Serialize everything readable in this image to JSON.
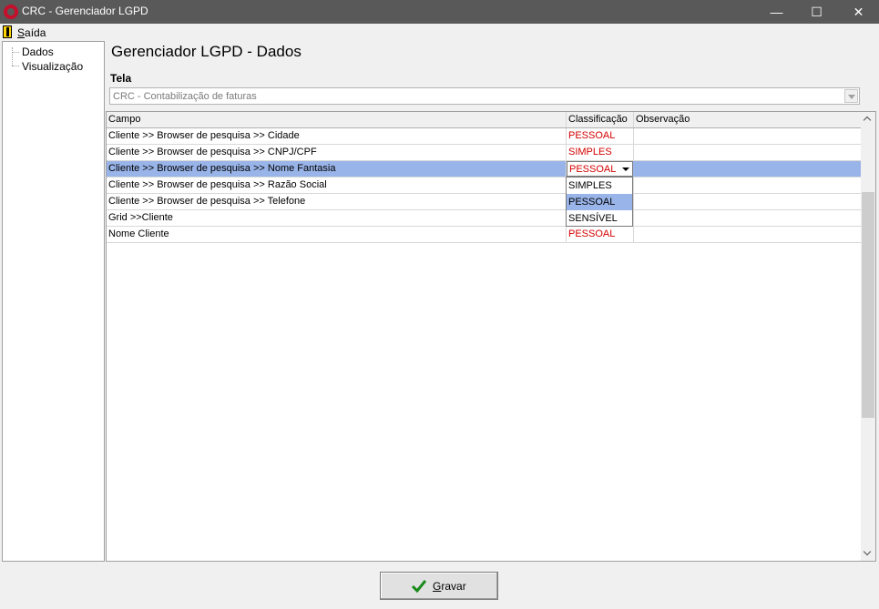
{
  "window": {
    "title": "CRC - Gerenciador LGPD",
    "minimize": "—",
    "maximize": "☐",
    "close": "✕"
  },
  "menu": {
    "exit_label_u": "S",
    "exit_label_rest": "aída"
  },
  "tree": {
    "items": [
      "Dados",
      "Visualização"
    ]
  },
  "page": {
    "title": "Gerenciador LGPD - Dados",
    "tela_label": "Tela"
  },
  "screen_select": {
    "value": "CRC - Contabilização de faturas"
  },
  "grid": {
    "columns": [
      "Campo",
      "Classificação",
      "Observação"
    ],
    "rows": [
      {
        "campo": "Cliente >> Browser de pesquisa >> Cidade",
        "classificacao": "PESSOAL",
        "observacao": ""
      },
      {
        "campo": "Cliente >> Browser de pesquisa >> CNPJ/CPF",
        "classificacao": "SIMPLES",
        "observacao": ""
      },
      {
        "campo": "Cliente >> Browser de pesquisa >> Nome Fantasia",
        "classificacao": "PESSOAL",
        "observacao": ""
      },
      {
        "campo": "Cliente >> Browser de pesquisa >> Razão Social",
        "classificacao": "",
        "observacao": ""
      },
      {
        "campo": "Cliente >> Browser de pesquisa >> Telefone",
        "classificacao": "",
        "observacao": ""
      },
      {
        "campo": "Grid >>Cliente",
        "classificacao": "",
        "observacao": ""
      },
      {
        "campo": "Nome Cliente",
        "classificacao": "PESSOAL",
        "observacao": ""
      }
    ],
    "selected_row": 2
  },
  "dropdown": {
    "options": [
      "SIMPLES",
      "PESSOAL",
      "SENSÍVEL"
    ],
    "highlighted": "PESSOAL"
  },
  "buttons": {
    "save_u": "G",
    "save_rest": "ravar"
  },
  "colors": {
    "classification_text": "#d50000",
    "selection": "#99b4e8",
    "titlebar": "#595959",
    "check": "#1a8a1a"
  },
  "icons": {
    "app": "crc-logo-icon",
    "exit": "exit-door-icon",
    "save": "checkmark-icon"
  }
}
